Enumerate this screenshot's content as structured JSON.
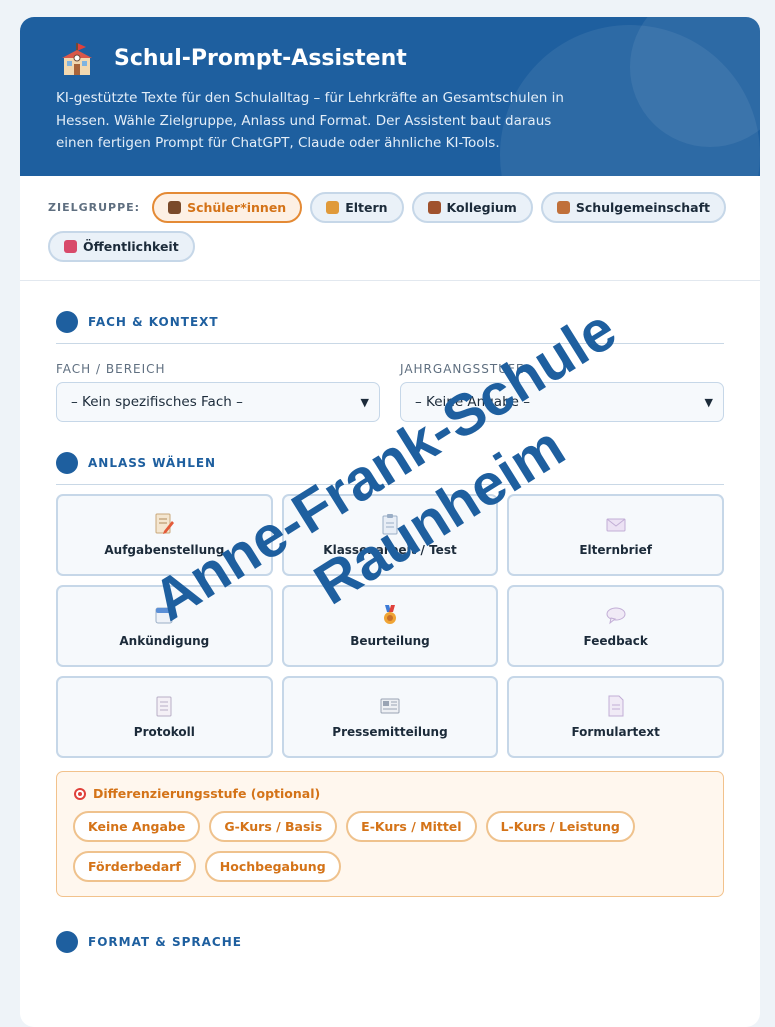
{
  "header": {
    "title": "Schul-Prompt-Assistent",
    "description": "KI-gestützte Texte für den Schulalltag – für Lehrkräfte an Gesamtschulen in Hessen. Wähle Zielgruppe, Anlass und Format. Der Assistent baut daraus einen fertigen Prompt für ChatGPT, Claude oder ähnliche KI-Tools."
  },
  "audience": {
    "label": "ZIELGRUPPE:",
    "options": [
      {
        "label": "Schüler*innen",
        "icon": "student-icon",
        "active": true,
        "color": "#7a4a2a"
      },
      {
        "label": "Eltern",
        "icon": "family-icon",
        "active": false,
        "color": "#e09a3a"
      },
      {
        "label": "Kollegium",
        "icon": "teachers-icon",
        "active": false,
        "color": "#a0522d"
      },
      {
        "label": "Schulgemeinschaft",
        "icon": "school-icon",
        "active": false,
        "color": "#c0703a"
      },
      {
        "label": "Öffentlichkeit",
        "icon": "megaphone-icon",
        "active": false,
        "color": "#d84a6a"
      }
    ]
  },
  "fach_kontext": {
    "title": "FACH & KONTEXT",
    "fach_label": "FACH / BEREICH",
    "fach_value": "– Kein spezifisches Fach –",
    "jahrgang_label": "JAHRGANGSSTUFE",
    "jahrgang_value": "– Keine Angabe –"
  },
  "anlass": {
    "title": "ANLASS WÄHLEN",
    "tiles": [
      {
        "label": "Aufgabenstellung",
        "icon": "memo-icon"
      },
      {
        "label": "Klassenarbeit / Test",
        "icon": "clipboard-icon"
      },
      {
        "label": "Elternbrief",
        "icon": "envelope-icon"
      },
      {
        "label": "Ankündigung",
        "icon": "calendar-icon"
      },
      {
        "label": "Beurteilung",
        "icon": "medal-icon"
      },
      {
        "label": "Feedback",
        "icon": "speech-bubble-icon"
      },
      {
        "label": "Protokoll",
        "icon": "notepad-icon"
      },
      {
        "label": "Pressemitteilung",
        "icon": "newspaper-icon"
      },
      {
        "label": "Formulartext",
        "icon": "document-icon"
      }
    ]
  },
  "differenzierung": {
    "title": "Differenzierungsstufe (optional)",
    "options": [
      "Keine Angabe",
      "G-Kurs / Basis",
      "E-Kurs / Mittel",
      "L-Kurs / Leistung",
      "Förderbedarf",
      "Hochbegabung"
    ]
  },
  "format": {
    "title": "FORMAT & SPRACHE"
  },
  "watermark": {
    "line1": "Anne-Frank-Schule",
    "line2": "Raunheim",
    "color": "#1e5f9f"
  },
  "colors": {
    "primary": "#1e5f9f",
    "accent": "#e48a35"
  }
}
